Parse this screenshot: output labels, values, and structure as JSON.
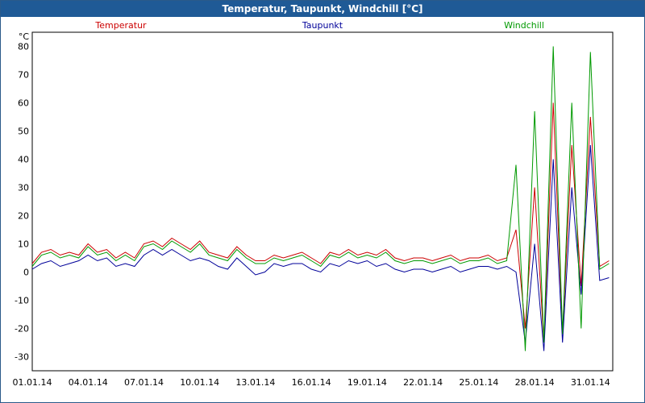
{
  "window": {
    "title": "Temperatur, Taupunkt, Windchill [°C]"
  },
  "chart_data": {
    "type": "line",
    "title": "Temperatur, Taupunkt, Windchill [°C]",
    "ylabel": "°C",
    "xlabel": "",
    "ylim": [
      -35,
      85
    ],
    "yticks": [
      80,
      70,
      60,
      50,
      40,
      30,
      20,
      10,
      0,
      -10,
      -20,
      -30
    ],
    "xlim": [
      0,
      31.2
    ],
    "xtick_labels": [
      "01.01.14",
      "04.01.14",
      "07.01.14",
      "10.01.14",
      "13.01.14",
      "16.01.14",
      "19.01.14",
      "22.01.14",
      "25.01.14",
      "28.01.14",
      "31.01.14"
    ],
    "xtick_values": [
      0,
      3,
      6,
      9,
      12,
      15,
      18,
      21,
      24,
      27,
      30
    ],
    "grid": true,
    "legend_position": "top",
    "series": [
      {
        "name": "Temperatur",
        "color": "#cc0000",
        "x": [
          0,
          0.5,
          1,
          1.5,
          2,
          2.5,
          3,
          3.5,
          4,
          4.5,
          5,
          5.5,
          6,
          6.5,
          7,
          7.5,
          8,
          8.5,
          9,
          9.5,
          10,
          10.5,
          11,
          11.5,
          12,
          12.5,
          13,
          13.5,
          14,
          14.5,
          15,
          15.5,
          16,
          16.5,
          17,
          17.5,
          18,
          18.5,
          19,
          19.5,
          20,
          20.5,
          21,
          21.5,
          22,
          22.5,
          23,
          23.5,
          24,
          24.5,
          25,
          25.5,
          26,
          26.5,
          27,
          27.5,
          28,
          28.5,
          29,
          29.5,
          30,
          30.5,
          31
        ],
        "values": [
          3,
          7,
          8,
          6,
          7,
          6,
          10,
          7,
          8,
          5,
          7,
          5,
          10,
          11,
          9,
          12,
          10,
          8,
          11,
          7,
          6,
          5,
          9,
          6,
          4,
          4,
          6,
          5,
          6,
          7,
          5,
          3,
          7,
          6,
          8,
          6,
          7,
          6,
          8,
          5,
          4,
          5,
          5,
          4,
          5,
          6,
          4,
          5,
          5,
          6,
          4,
          5,
          15,
          -20,
          30,
          -25,
          60,
          -22,
          45,
          -5,
          55,
          2,
          4
        ]
      },
      {
        "name": "Taupunkt",
        "color": "#000099",
        "x": [
          0,
          0.5,
          1,
          1.5,
          2,
          2.5,
          3,
          3.5,
          4,
          4.5,
          5,
          5.5,
          6,
          6.5,
          7,
          7.5,
          8,
          8.5,
          9,
          9.5,
          10,
          10.5,
          11,
          11.5,
          12,
          12.5,
          13,
          13.5,
          14,
          14.5,
          15,
          15.5,
          16,
          16.5,
          17,
          17.5,
          18,
          18.5,
          19,
          19.5,
          20,
          20.5,
          21,
          21.5,
          22,
          22.5,
          23,
          23.5,
          24,
          24.5,
          25,
          25.5,
          26,
          26.5,
          27,
          27.5,
          28,
          28.5,
          29,
          29.5,
          30,
          30.5,
          31
        ],
        "values": [
          1,
          3,
          4,
          2,
          3,
          4,
          6,
          4,
          5,
          2,
          3,
          2,
          6,
          8,
          6,
          8,
          6,
          4,
          5,
          4,
          2,
          1,
          5,
          2,
          -1,
          0,
          3,
          2,
          3,
          3,
          1,
          0,
          3,
          2,
          4,
          3,
          4,
          2,
          3,
          1,
          0,
          1,
          1,
          0,
          1,
          2,
          0,
          1,
          2,
          2,
          1,
          2,
          0,
          -25,
          10,
          -28,
          40,
          -25,
          30,
          -8,
          45,
          -3,
          -2
        ]
      },
      {
        "name": "Windchill",
        "color": "#009900",
        "x": [
          0,
          0.5,
          1,
          1.5,
          2,
          2.5,
          3,
          3.5,
          4,
          4.5,
          5,
          5.5,
          6,
          6.5,
          7,
          7.5,
          8,
          8.5,
          9,
          9.5,
          10,
          10.5,
          11,
          11.5,
          12,
          12.5,
          13,
          13.5,
          14,
          14.5,
          15,
          15.5,
          16,
          16.5,
          17,
          17.5,
          18,
          18.5,
          19,
          19.5,
          20,
          20.5,
          21,
          21.5,
          22,
          22.5,
          23,
          23.5,
          24,
          24.5,
          25,
          25.5,
          26,
          26.5,
          27,
          27.5,
          28,
          28.5,
          29,
          29.5,
          30,
          30.5,
          31
        ],
        "values": [
          2,
          6,
          7,
          5,
          6,
          5,
          9,
          6,
          7,
          4,
          6,
          4,
          9,
          10,
          8,
          11,
          9,
          7,
          10,
          6,
          5,
          4,
          8,
          5,
          3,
          3,
          5,
          4,
          5,
          6,
          4,
          2,
          6,
          5,
          7,
          5,
          6,
          5,
          7,
          4,
          3,
          4,
          4,
          3,
          4,
          5,
          3,
          4,
          4,
          5,
          3,
          4,
          38,
          -28,
          57,
          -25,
          80,
          -22,
          60,
          -20,
          78,
          1,
          3
        ]
      }
    ]
  }
}
